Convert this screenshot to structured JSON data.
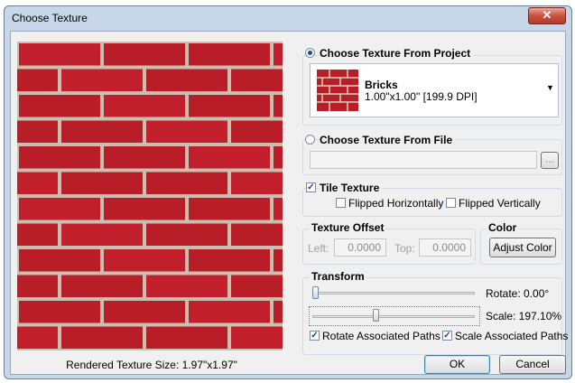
{
  "window": {
    "title": "Choose Texture",
    "close_glyph": "✕"
  },
  "preview": {
    "rendered_size": "Rendered Texture Size: 1.97\"x1.97\""
  },
  "project": {
    "heading": "Choose Texture From Project",
    "selected": true,
    "texture_name": "Bricks",
    "texture_info": "1.00\"x1.00\" [199.9 DPI]"
  },
  "file": {
    "heading": "Choose Texture From File",
    "selected": false,
    "path_value": "",
    "browse_label": "..."
  },
  "tile": {
    "label": "Tile Texture",
    "checked": true,
    "flip_h": {
      "label": "Flipped Horizontally",
      "checked": false
    },
    "flip_v": {
      "label": "Flipped Vertically",
      "checked": false
    }
  },
  "offset": {
    "heading": "Texture Offset",
    "left_label": "Left:",
    "left_value": "0.0000",
    "top_label": "Top:",
    "top_value": "0.0000"
  },
  "color": {
    "heading": "Color",
    "button_label": "Adjust Color"
  },
  "transform": {
    "heading": "Transform",
    "rotate_text": "Rotate: 0.00°",
    "rotate_fraction": 0.0,
    "scale_text": "Scale: 197.10%",
    "scale_fraction": 0.39,
    "rotate_paths": {
      "label": "Rotate Associated Paths",
      "checked": true
    },
    "scale_paths": {
      "label": "Scale Associated Paths",
      "checked": true
    }
  },
  "buttons": {
    "ok": "OK",
    "cancel": "Cancel"
  },
  "colors": {
    "brick": "#b81d28",
    "mortar": "#c9bfb0",
    "title_bar": "#c7d6e8"
  }
}
